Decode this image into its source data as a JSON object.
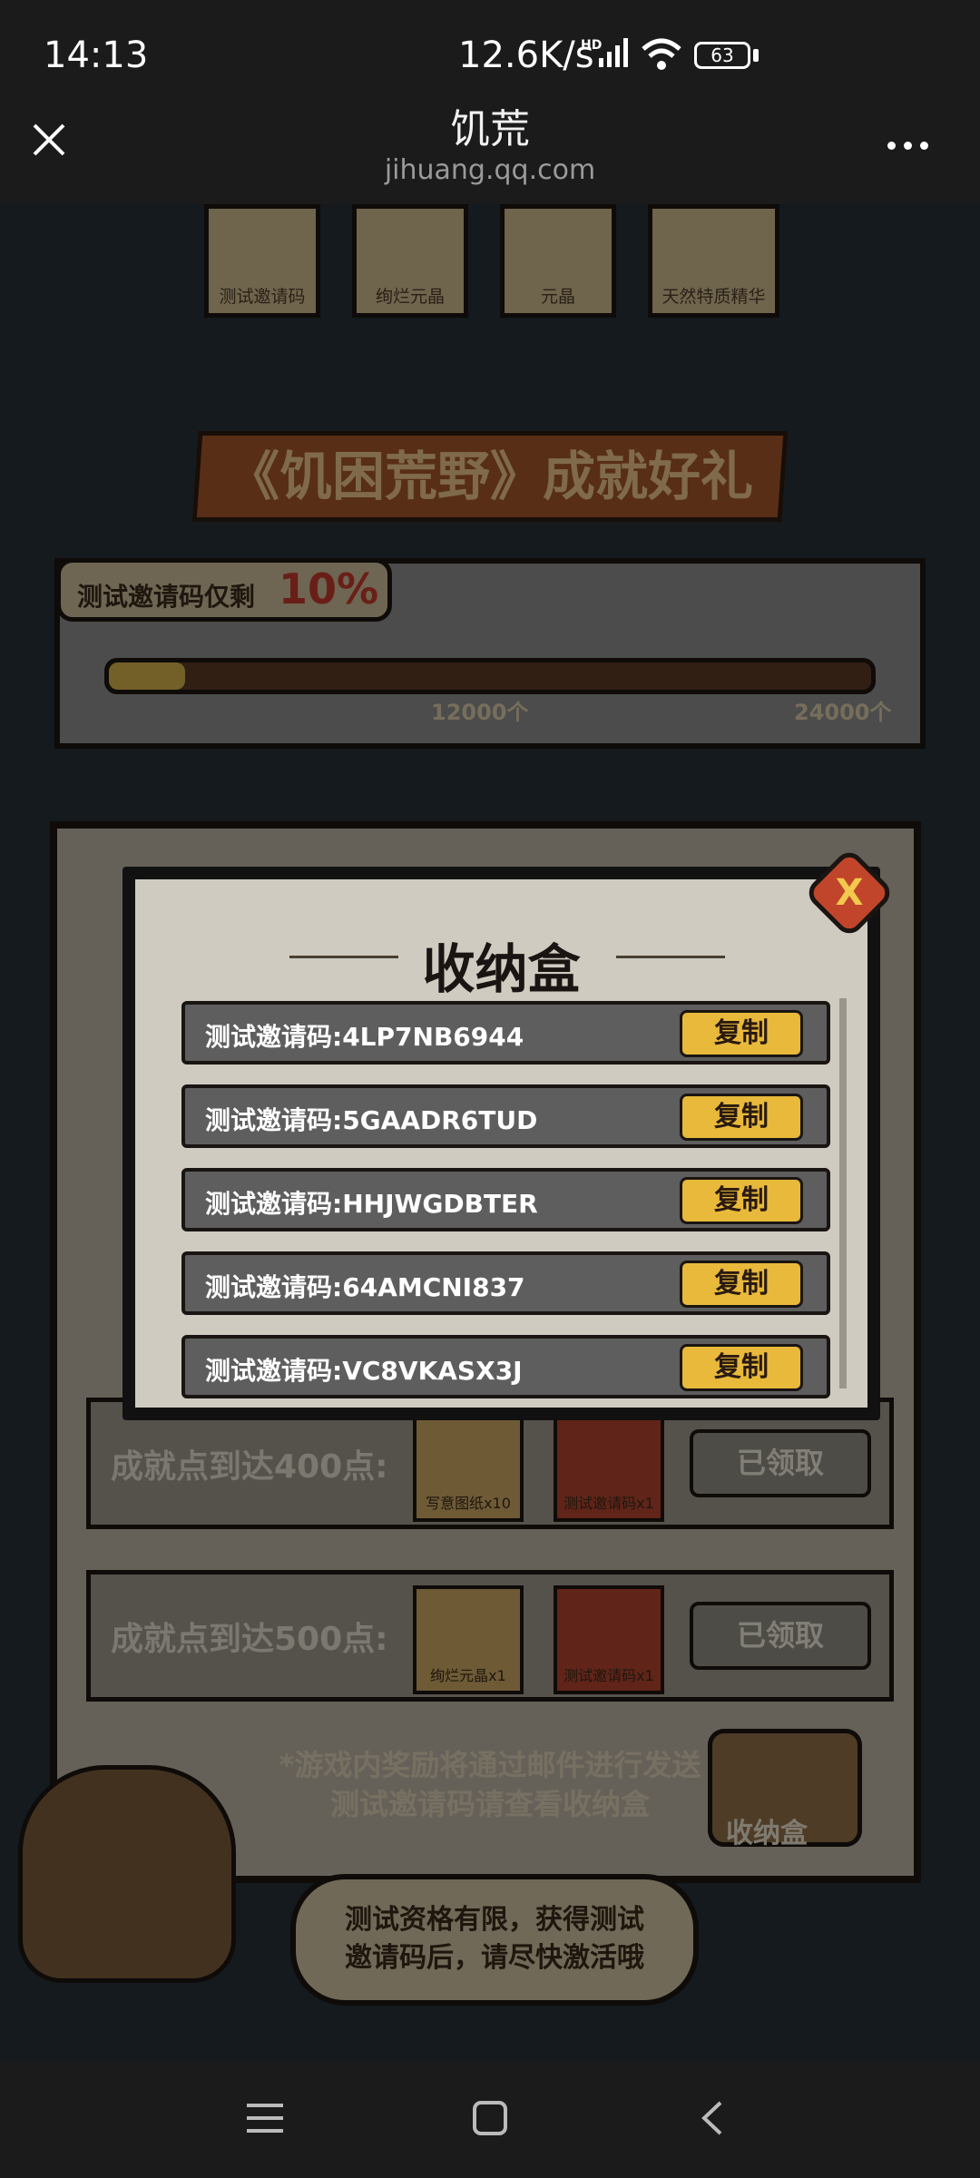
{
  "status_bar": {
    "time": "14:13",
    "network_speed": "12.6K/s",
    "hd": "HD",
    "battery": "63"
  },
  "title_bar": {
    "title": "饥荒",
    "subtitle": "jihuang.qq.com"
  },
  "rewards_strip": [
    "测试邀请码",
    "绚烂元晶",
    "元晶",
    "天然特质精华"
  ],
  "banner": "《饥困荒野》成就好礼",
  "progress": {
    "label": "测试邀请码仅剩",
    "percent_text": "10%",
    "remaining_fraction": 0.1,
    "mark_mid": "12000个",
    "mark_end": "24000个"
  },
  "milestones": [
    {
      "text": "成就点到达400点:",
      "items": [
        "写意图纸x10",
        "测试邀请码x1"
      ],
      "status": "已领取"
    },
    {
      "text": "成就点到达500点:",
      "items": [
        "绚烂元晶x1",
        "测试邀请码x1"
      ],
      "status": "已领取"
    }
  ],
  "notes": {
    "line1": "*游戏内奖励将通过邮件进行发送",
    "line2": "测试邀请码请查看收纳盒"
  },
  "chest_label": "收纳盒",
  "speech": {
    "line1": "测试资格有限，获得测试",
    "line2": "邀请码后，请尽快激活哦"
  },
  "modal": {
    "title": "收纳盒",
    "close_label": "X",
    "codes": [
      {
        "text": "测试邀请码:4LP7NB6944",
        "button": "复制"
      },
      {
        "text": "测试邀请码:5GAADR6TUD",
        "button": "复制"
      },
      {
        "text": "测试邀请码:HHJWGDBTER",
        "button": "复制"
      },
      {
        "text": "测试邀请码:64AMCNI837",
        "button": "复制"
      },
      {
        "text": "测试邀请码:VC8VKASX3J",
        "button": "复制"
      }
    ]
  },
  "colors": {
    "accent_gold": "#e8b93a",
    "danger_red": "#c0452a",
    "progress_red": "#c0392b"
  }
}
